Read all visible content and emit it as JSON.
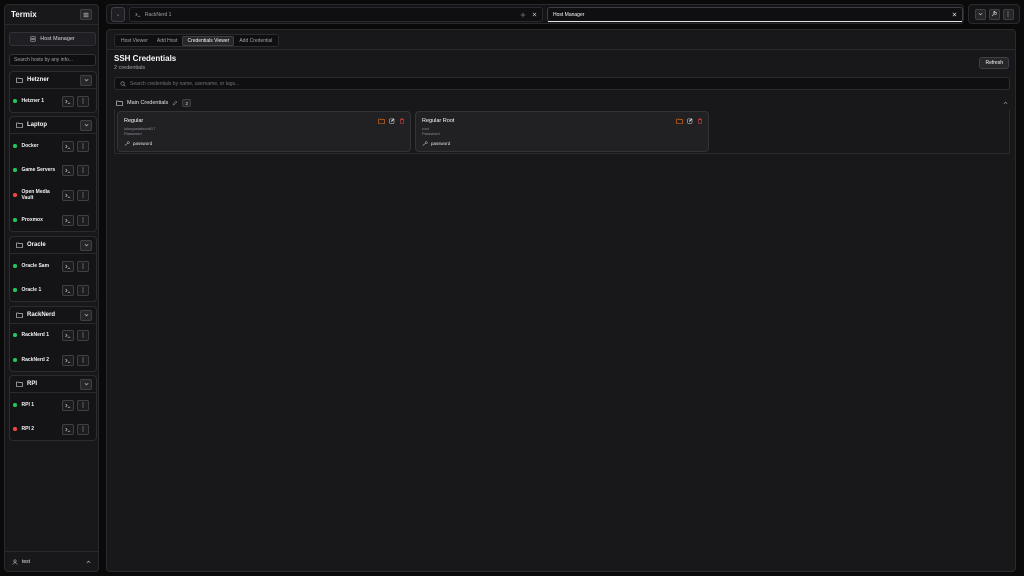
{
  "sidebar": {
    "brand": "Termix",
    "host_manager_label": "Host Manager",
    "search_placeholder": "Search hosts by any info...",
    "groups": [
      {
        "name": "Hetzner",
        "hosts": [
          {
            "name": "Hetzner 1",
            "status": "online"
          }
        ]
      },
      {
        "name": "Laptop",
        "hosts": [
          {
            "name": "Docker",
            "status": "online"
          },
          {
            "name": "Game Servers",
            "status": "online"
          },
          {
            "name": "Open Media Vault",
            "status": "offline"
          },
          {
            "name": "Proxmox",
            "status": "online"
          }
        ]
      },
      {
        "name": "Oracle",
        "hosts": [
          {
            "name": "Oracle Sam",
            "status": "online"
          },
          {
            "name": "Oracle 1",
            "status": "online"
          }
        ]
      },
      {
        "name": "RackNerd",
        "hosts": [
          {
            "name": "RackNerd 1",
            "status": "online"
          },
          {
            "name": "RackNerd 2",
            "status": "online"
          }
        ]
      },
      {
        "name": "RPI",
        "hosts": [
          {
            "name": "RPI 1",
            "status": "online"
          },
          {
            "name": "RPI 2",
            "status": "offline"
          }
        ]
      }
    ],
    "user": "test"
  },
  "topbar": {
    "tabs": [
      {
        "label": "RackNerd 1"
      },
      {
        "label": "Host Manager"
      }
    ]
  },
  "main": {
    "subtabs": [
      "Host Viewer",
      "Add Host",
      "Credentials Viewer",
      "Add Credential"
    ],
    "active_subtab": 2,
    "title": "SSH Credentials",
    "subtitle": "2 credentials",
    "refresh_label": "Refresh",
    "search_placeholder": "Search credentials by name, username, or tags...",
    "folder": {
      "name": "Main Credentials",
      "count": "2"
    },
    "credentials": [
      {
        "name": "Regular",
        "username": "lukegustafson617",
        "type": "Password",
        "auth": "password"
      },
      {
        "name": "Regular Root",
        "username": "root",
        "type": "Password",
        "auth": "password"
      }
    ]
  },
  "colors": {
    "online": "#22c55e",
    "offline": "#ef4444",
    "folder_icon": "#f97316",
    "delete_icon": "#ef4444"
  }
}
